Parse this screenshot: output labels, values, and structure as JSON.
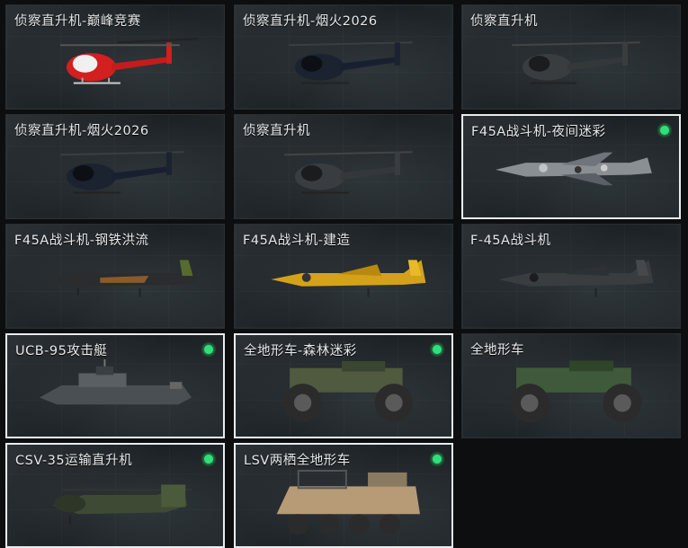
{
  "vehicles": [
    {
      "label": "侦察直升机-巅峰竞赛",
      "selected": false,
      "icon": "heli-red"
    },
    {
      "label": "侦察直升机-烟火2026",
      "selected": false,
      "icon": "heli-dark"
    },
    {
      "label": "侦察直升机",
      "selected": false,
      "icon": "heli-gray"
    },
    {
      "label": "侦察直升机-烟火2026",
      "selected": false,
      "icon": "heli-dark"
    },
    {
      "label": "侦察直升机",
      "selected": false,
      "icon": "heli-gray"
    },
    {
      "label": "F45A战斗机-夜间迷彩",
      "selected": true,
      "icon": "jet-camo"
    },
    {
      "label": "F45A战斗机-钢铁洪流",
      "selected": false,
      "icon": "jet-bronze"
    },
    {
      "label": "F45A战斗机-建造",
      "selected": false,
      "icon": "jet-yellow"
    },
    {
      "label": "F-45A战斗机",
      "selected": false,
      "icon": "jet-gray"
    },
    {
      "label": "UCB-95攻击艇",
      "selected": true,
      "icon": "boat"
    },
    {
      "label": "全地形车-森林迷彩",
      "selected": true,
      "icon": "atv-camo"
    },
    {
      "label": "全地形车",
      "selected": false,
      "icon": "atv-green"
    },
    {
      "label": "CSV-35运输直升机",
      "selected": true,
      "icon": "transport-heli"
    },
    {
      "label": "LSV两栖全地形车",
      "selected": true,
      "icon": "amphibious-atv"
    }
  ],
  "colors": {
    "selected_indicator": "#2fe07a",
    "border_selected": "#e8ecee"
  }
}
